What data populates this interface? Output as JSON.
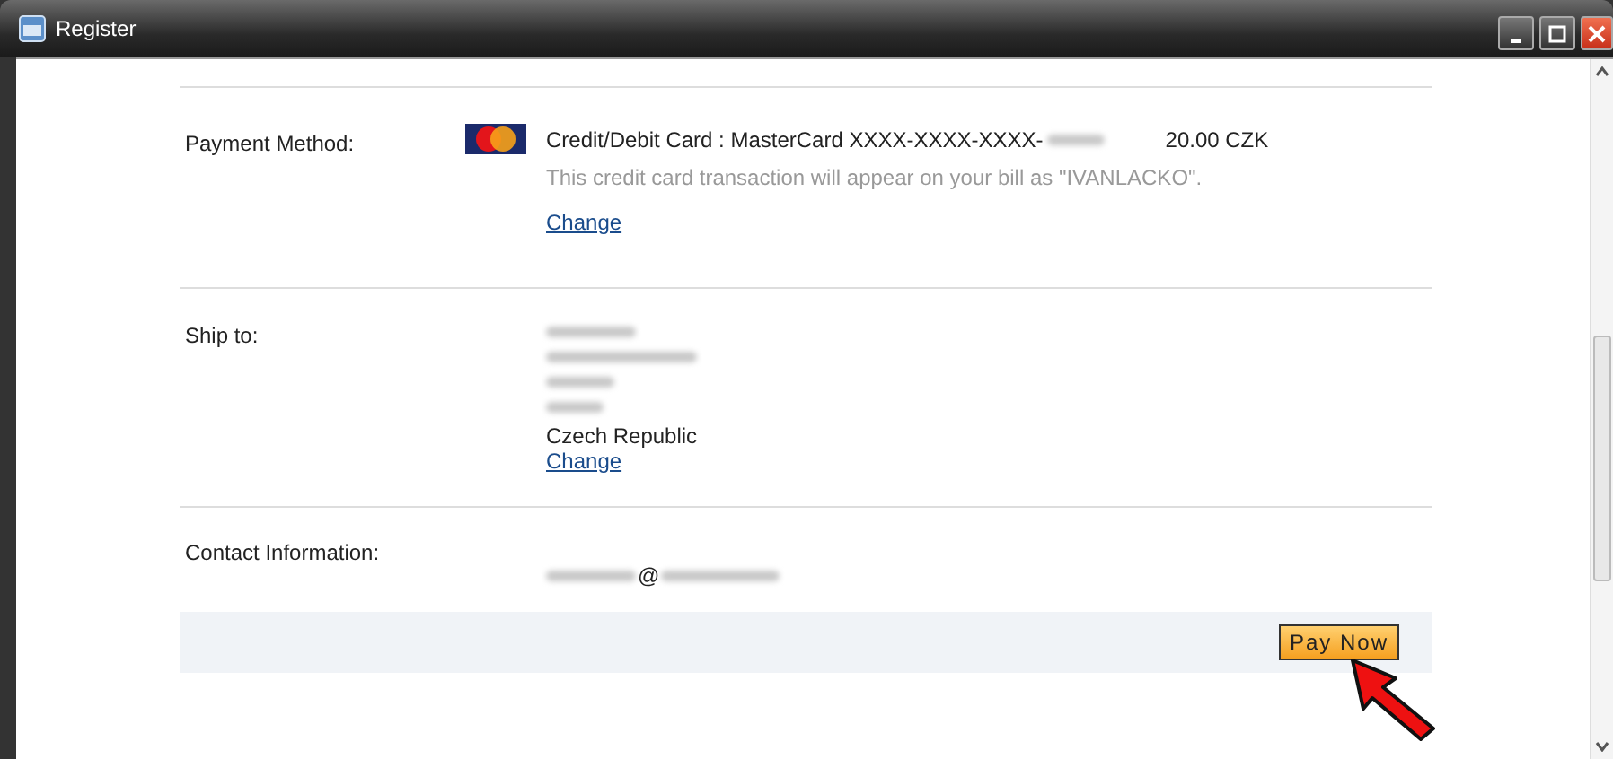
{
  "window": {
    "title": "Register"
  },
  "payment": {
    "label": "Payment Method:",
    "card": "Credit/Debit Card : MasterCard XXXX-XXXX-XXXX-",
    "amount": "20.00 CZK",
    "note": "This credit card transaction will appear on your bill as \"IVANLACKO\".",
    "change": "Change"
  },
  "ship_to": {
    "label": "Ship to:",
    "country": "Czech Republic",
    "change": "Change"
  },
  "contact": {
    "label": "Contact Information:",
    "email_visible": "@"
  },
  "pay_button": {
    "label": "Pay Now"
  }
}
